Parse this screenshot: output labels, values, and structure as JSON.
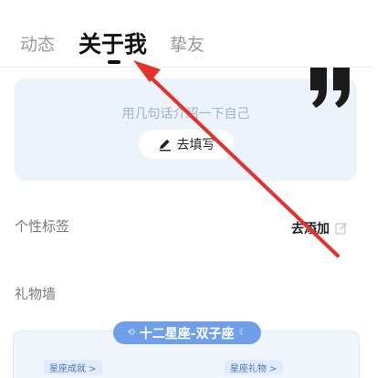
{
  "tabs": [
    {
      "label": "动态"
    },
    {
      "label": "关于我",
      "active": true
    },
    {
      "label": "挚友"
    }
  ],
  "intro": {
    "prompt": "用几句话介绍一下自己",
    "button_label": "去填写"
  },
  "tags": {
    "title": "个性标签",
    "action_label": "去添加"
  },
  "gifts": {
    "title": "礼物墙",
    "badge_label": "十二星座-双子座",
    "achievements_chip": "星座成就 >",
    "gifts_chip": "星座礼物 >"
  },
  "colors": {
    "accent_blue": "#6f9fe9",
    "card_bg": "#edf3fb",
    "annotation_red": "#e8302a"
  },
  "icons": [
    "pen-icon",
    "quote-icon",
    "edit-icon"
  ]
}
